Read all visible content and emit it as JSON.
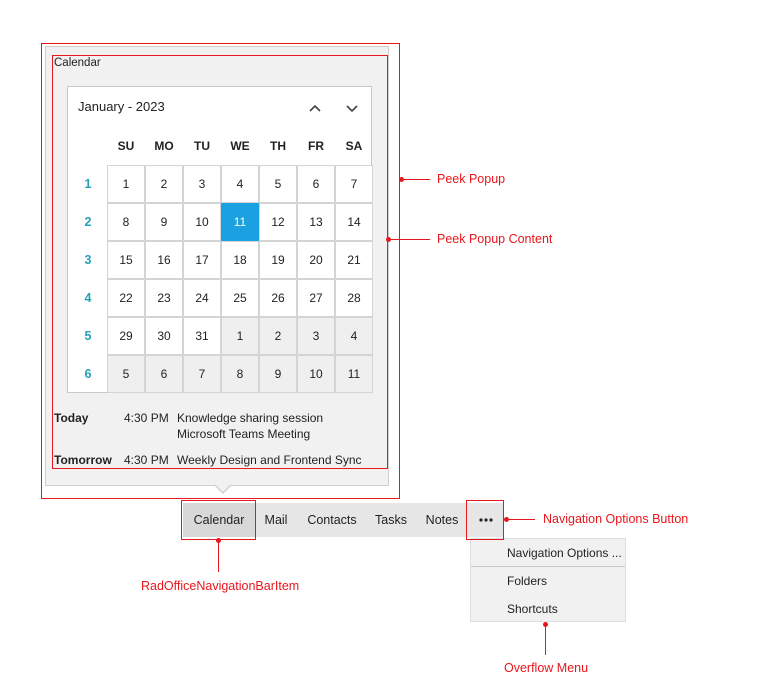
{
  "popup": {
    "title": "Calendar"
  },
  "calendar": {
    "month_year": "January - 2023",
    "day_headers": [
      "SU",
      "MO",
      "TU",
      "WE",
      "TH",
      "FR",
      "SA"
    ],
    "weeks": [
      {
        "num": "1",
        "days": [
          "1",
          "2",
          "3",
          "4",
          "5",
          "6",
          "7"
        ],
        "other": [
          false,
          false,
          false,
          false,
          false,
          false,
          false
        ]
      },
      {
        "num": "2",
        "days": [
          "8",
          "9",
          "10",
          "11",
          "12",
          "13",
          "14"
        ],
        "other": [
          false,
          false,
          false,
          false,
          false,
          false,
          false
        ]
      },
      {
        "num": "3",
        "days": [
          "15",
          "16",
          "17",
          "18",
          "19",
          "20",
          "21"
        ],
        "other": [
          false,
          false,
          false,
          false,
          false,
          false,
          false
        ]
      },
      {
        "num": "4",
        "days": [
          "22",
          "23",
          "24",
          "25",
          "26",
          "27",
          "28"
        ],
        "other": [
          false,
          false,
          false,
          false,
          false,
          false,
          false
        ]
      },
      {
        "num": "5",
        "days": [
          "29",
          "30",
          "31",
          "1",
          "2",
          "3",
          "4"
        ],
        "other": [
          false,
          false,
          false,
          true,
          true,
          true,
          true
        ]
      },
      {
        "num": "6",
        "days": [
          "5",
          "6",
          "7",
          "8",
          "9",
          "10",
          "11"
        ],
        "other": [
          true,
          true,
          true,
          true,
          true,
          true,
          true
        ]
      }
    ],
    "selected_day": "11",
    "accent_color": "#1ba1e2",
    "week_number_color": "#25a0b8"
  },
  "agenda": [
    {
      "day": "Today",
      "time": "4:30 PM",
      "title": "Knowledge sharing session",
      "subtitle": "Microsoft Teams Meeting"
    },
    {
      "day": "Tomorrow",
      "time": "4:30 PM",
      "title": "Weekly Design and Frontend Sync",
      "subtitle": ""
    }
  ],
  "navbar": {
    "items": [
      "Calendar",
      "Mail",
      "Contacts",
      "Tasks",
      "Notes"
    ],
    "active": "Calendar",
    "more_icon": "ellipsis-icon"
  },
  "overflow_menu": {
    "items": [
      "Navigation Options ...",
      "Folders",
      "Shortcuts"
    ]
  },
  "annotations": {
    "peek_popup": "Peek Popup",
    "peek_popup_content": "Peek Popup Content",
    "navigation_options_button": "Navigation Options Button",
    "nav_bar_item": "RadOfficeNavigationBarItem",
    "overflow_menu": "Overflow Menu",
    "color": "#e8161d"
  }
}
